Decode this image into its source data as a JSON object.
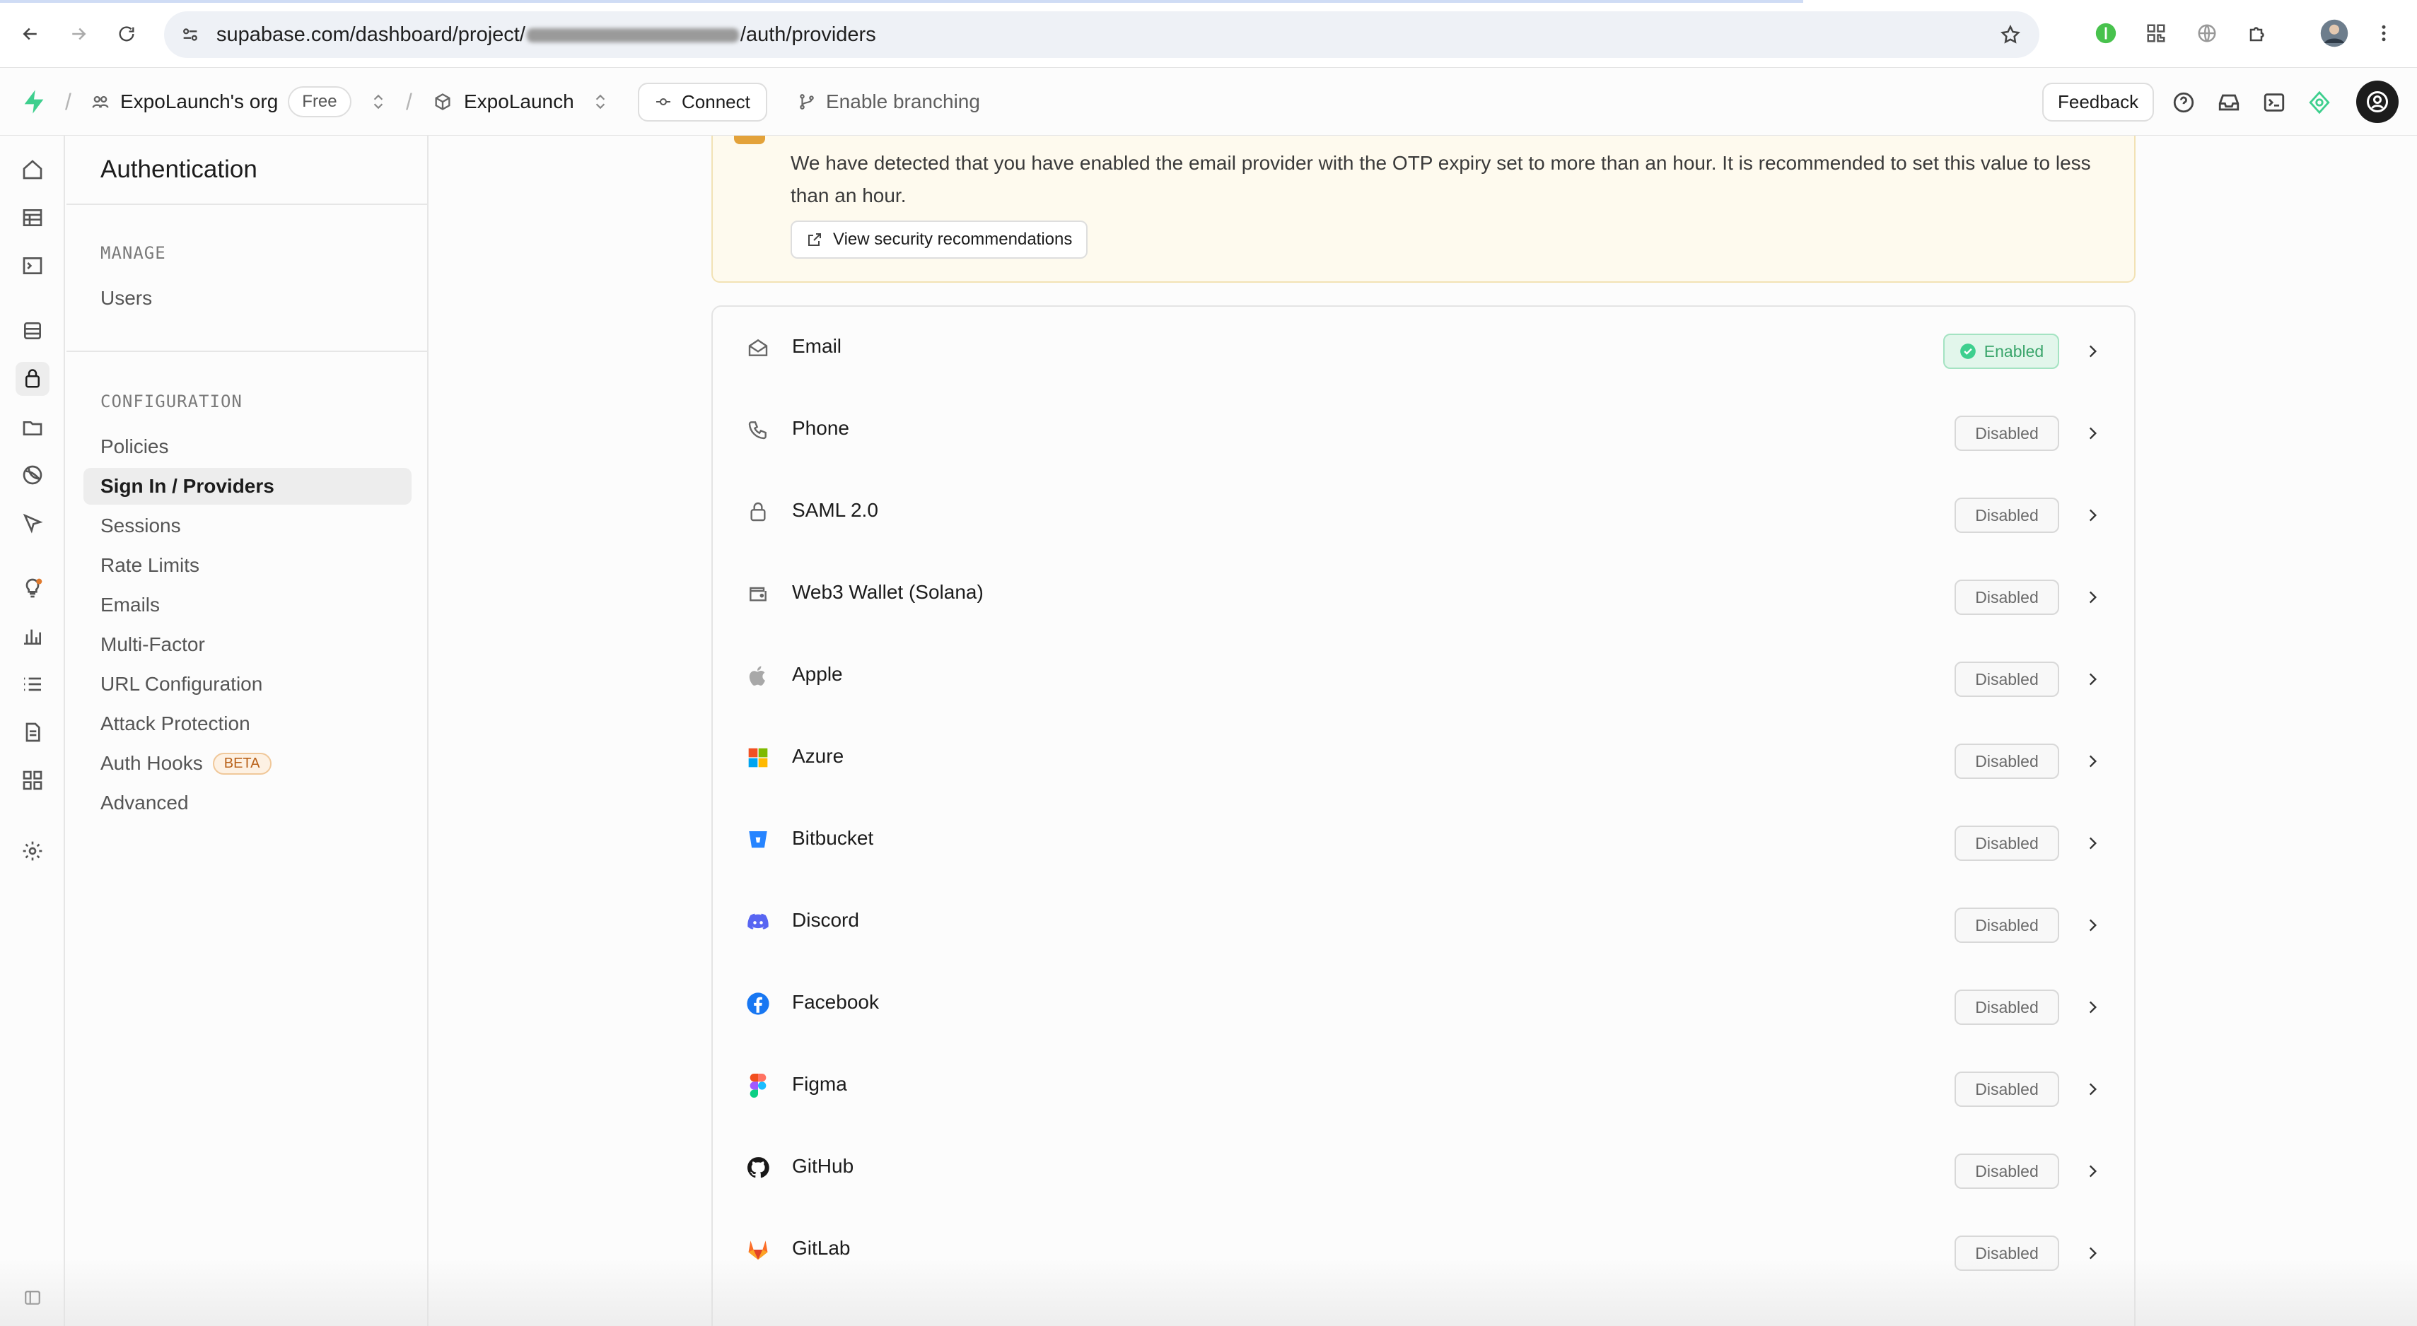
{
  "browser": {
    "url_prefix": "supabase.com/dashboard/project/",
    "url_suffix": "/auth/providers"
  },
  "header": {
    "org_name": "ExpoLaunch's org",
    "plan": "Free",
    "project_name": "ExpoLaunch",
    "connect_label": "Connect",
    "branching_label": "Enable branching",
    "feedback_label": "Feedback"
  },
  "menu": {
    "title": "Authentication",
    "manage_heading": "MANAGE",
    "manage_items": [
      "Users"
    ],
    "config_heading": "CONFIGURATION",
    "config_items": [
      "Policies",
      "Sign In / Providers",
      "Sessions",
      "Rate Limits",
      "Emails",
      "Multi-Factor",
      "URL Configuration",
      "Attack Protection",
      "Auth Hooks",
      "Advanced"
    ],
    "active_item": "Sign In / Providers",
    "beta_badge": "BETA"
  },
  "alert": {
    "message": "We have detected that you have enabled the email provider with the OTP expiry set to more than an hour. It is recommended to set this value to less than an hour.",
    "button_label": "View security recommendations"
  },
  "providers": [
    {
      "name": "Email",
      "status": "Enabled",
      "icon": "mail-icon"
    },
    {
      "name": "Phone",
      "status": "Disabled",
      "icon": "phone-icon"
    },
    {
      "name": "SAML 2.0",
      "status": "Disabled",
      "icon": "lock-icon"
    },
    {
      "name": "Web3 Wallet (Solana)",
      "status": "Disabled",
      "icon": "wallet-icon"
    },
    {
      "name": "Apple",
      "status": "Disabled",
      "icon": "apple-icon"
    },
    {
      "name": "Azure",
      "status": "Disabled",
      "icon": "azure-icon"
    },
    {
      "name": "Bitbucket",
      "status": "Disabled",
      "icon": "bitbucket-icon"
    },
    {
      "name": "Discord",
      "status": "Disabled",
      "icon": "discord-icon"
    },
    {
      "name": "Facebook",
      "status": "Disabled",
      "icon": "facebook-icon"
    },
    {
      "name": "Figma",
      "status": "Disabled",
      "icon": "figma-icon"
    },
    {
      "name": "GitHub",
      "status": "Disabled",
      "icon": "github-icon"
    },
    {
      "name": "GitLab",
      "status": "Disabled",
      "icon": "gitlab-icon"
    }
  ],
  "colors": {
    "brand_green": "#3ecf8e",
    "enabled_text": "#3aa56b",
    "alert_bg": "#fefaee"
  }
}
